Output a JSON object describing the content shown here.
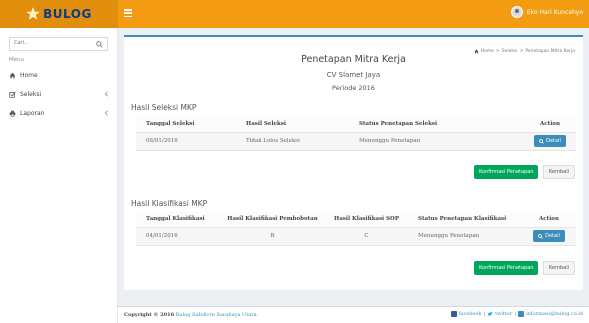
{
  "brand": {
    "name": "BULOG"
  },
  "user": {
    "name": "Eko Hari Kuncahyo"
  },
  "sidebar": {
    "search_placeholder": "Cari...",
    "heading": "Menu",
    "items": [
      {
        "label": "Home",
        "icon": "home-icon"
      },
      {
        "label": "Seleksi",
        "icon": "check-square-icon"
      },
      {
        "label": "Laporan",
        "icon": "print-icon"
      }
    ]
  },
  "breadcrumb": {
    "items": [
      "Home",
      "Seleksi",
      "Penetapan Mitra Kerja"
    ],
    "sep": ">"
  },
  "page": {
    "title": "Penetapan Mitra Kerja",
    "company": "CV Slamet Jaya",
    "period": "Periode 2016"
  },
  "seleksi": {
    "title": "Hasil Seleksi MKP",
    "headers": [
      "Tanggal Seleksi",
      "Hasil Seleksi",
      "Status Penetapan Seleksi",
      "Action"
    ],
    "row": {
      "date": "08/01/2016",
      "result": "Tidak Lolos Seleksi",
      "status": "Menunggu Penetapan",
      "action": "Detail"
    },
    "confirm_label": "Konfirmasi Penetapan",
    "cancel_label": "Kembali"
  },
  "klasifikasi": {
    "title": "Hasil Klasifikasi MKP",
    "headers": [
      "Tanggal Klasifikasi",
      "Hasil Klasifikasi Pembobotan",
      "Hasil Klasifikasi SOP",
      "Status Penetapan Klasifikasi",
      "Action"
    ],
    "row": {
      "date": "04/01/2016",
      "bobot": "B",
      "sop": "C",
      "status": "Menunggu Penetapan",
      "action": "Detail"
    },
    "confirm_label": "Konfirmasi Penetapan",
    "cancel_label": "Kembali"
  },
  "footer": {
    "prefix": "Copyright © 2016",
    "company": "Bulog Subdivre Surabaya Utara.",
    "facebook": "facebook",
    "twitter": "twitter",
    "email": "informasi@bulog.co.id",
    "sep": "|"
  },
  "colors": {
    "topbar": "#f39c12",
    "primary": "#3c8dbc",
    "success": "#00a65a",
    "brand_text": "#0b3c8c"
  }
}
